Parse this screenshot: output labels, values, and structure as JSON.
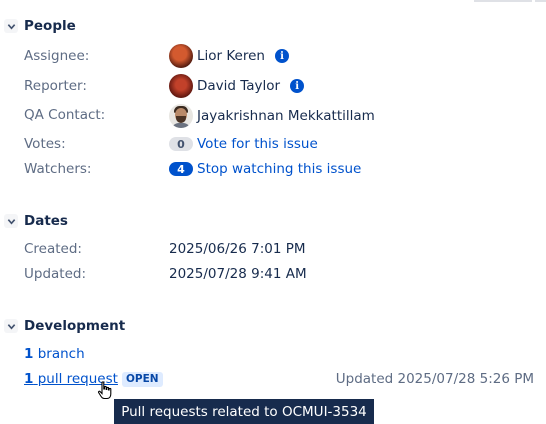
{
  "people": {
    "title": "People",
    "assignee": {
      "label": "Assignee:",
      "name": "Lior Keren",
      "icon": "info-icon"
    },
    "reporter": {
      "label": "Reporter:",
      "name": "David Taylor",
      "icon": "info-icon"
    },
    "qa_contact": {
      "label": "QA Contact:",
      "name": "Jayakrishnan Mekkattillam"
    },
    "votes": {
      "label": "Votes:",
      "count": "0",
      "link": "Vote for this issue"
    },
    "watchers": {
      "label": "Watchers:",
      "count": "4",
      "link": "Stop watching this issue"
    }
  },
  "dates": {
    "title": "Dates",
    "created": {
      "label": "Created:",
      "value": "2025/06/26 7:01 PM"
    },
    "updated": {
      "label": "Updated:",
      "value": "2025/07/28 9:41 AM"
    }
  },
  "development": {
    "title": "Development",
    "branch": {
      "count": "1",
      "text": "branch"
    },
    "pull_request": {
      "count": "1",
      "text": "pull request",
      "status": "OPEN",
      "updated": "Updated 2025/07/28 5:26 PM"
    },
    "tooltip": "Pull requests related to OCMUI-3534"
  },
  "colors": {
    "link": "#0052cc",
    "label": "#5e6c84",
    "tooltip_bg": "#172b4d",
    "lozenge_bg": "#deebff"
  }
}
